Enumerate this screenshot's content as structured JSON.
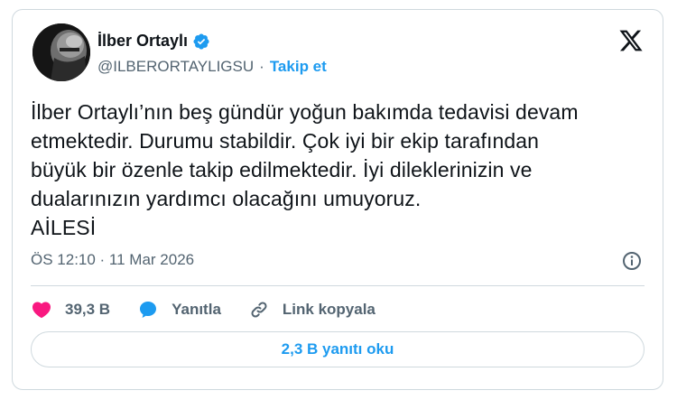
{
  "author": {
    "name": "İlber Ortaylı",
    "handle": "@ILBERORTAYLIGSU",
    "separator": "·",
    "follow_label": "Takip et",
    "verified_icon": "verified-badge-icon",
    "avatar_icon": "avatar-photo"
  },
  "tweet": {
    "text": "İlber Ortaylı’nın beş gündür yoğun bakımda tedavisi devam\netmektedir. Durumu stabildir. Çok iyi bir ekip tarafından\nbüyük bir özenle takip edilmektedir. İyi dileklerinizin ve\ndualarınızın yardımcı olacağını umuyoruz.\nAİLESİ",
    "timestamp": "ÖS 12:10 · 11 Mar 2026"
  },
  "actions": {
    "like_count": "39,3 B",
    "reply_label": "Yanıtla",
    "copy_link_label": "Link kopyala"
  },
  "replies_button": "2,3 B yanıtı oku",
  "colors": {
    "accent": "#1d9bf0",
    "like": "#f91880",
    "text": "#0f1419",
    "muted": "#536471",
    "border": "#cfd9de"
  }
}
